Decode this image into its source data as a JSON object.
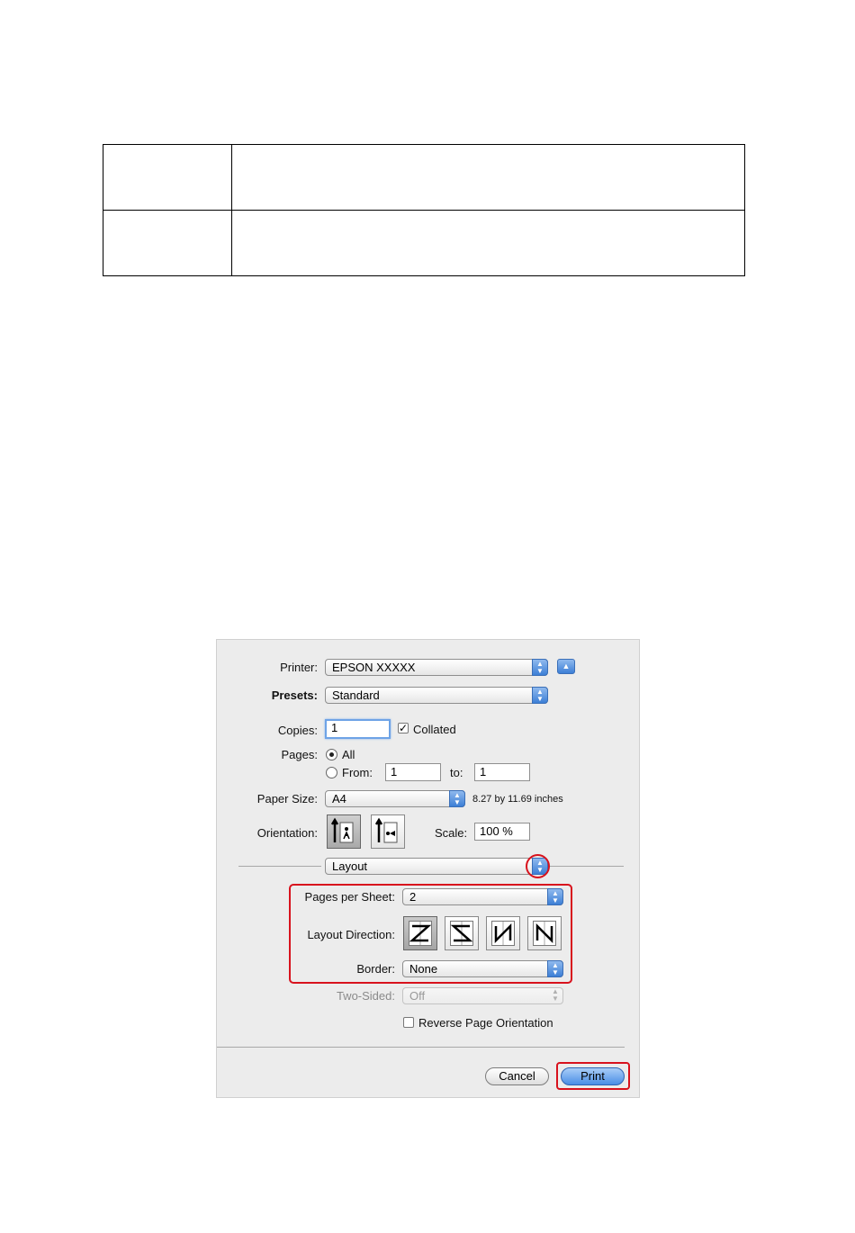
{
  "printer": {
    "label": "Printer:",
    "value": "EPSON XXXXX"
  },
  "presets": {
    "label": "Presets:",
    "value": "Standard"
  },
  "copies": {
    "label": "Copies:",
    "value": "1",
    "collated_label": "Collated"
  },
  "pages": {
    "label": "Pages:",
    "all_label": "All",
    "from_label": "From:",
    "from_value": "1",
    "to_label": "to:",
    "to_value": "1"
  },
  "paper_size": {
    "label": "Paper Size:",
    "value": "A4",
    "dimensions": "8.27 by 11.69 inches"
  },
  "orientation": {
    "label": "Orientation:"
  },
  "scale": {
    "label": "Scale:",
    "value": "100 %"
  },
  "panel": {
    "value": "Layout"
  },
  "pages_per_sheet": {
    "label": "Pages per Sheet:",
    "value": "2"
  },
  "layout_direction": {
    "label": "Layout Direction:"
  },
  "border": {
    "label": "Border:",
    "value": "None"
  },
  "two_sided": {
    "label": "Two-Sided:",
    "value": "Off"
  },
  "reverse": {
    "label": "Reverse Page Orientation"
  },
  "buttons": {
    "cancel": "Cancel",
    "print": "Print"
  },
  "colors": {
    "highlight": "#d8121d",
    "accent": "#3d7fd6"
  }
}
